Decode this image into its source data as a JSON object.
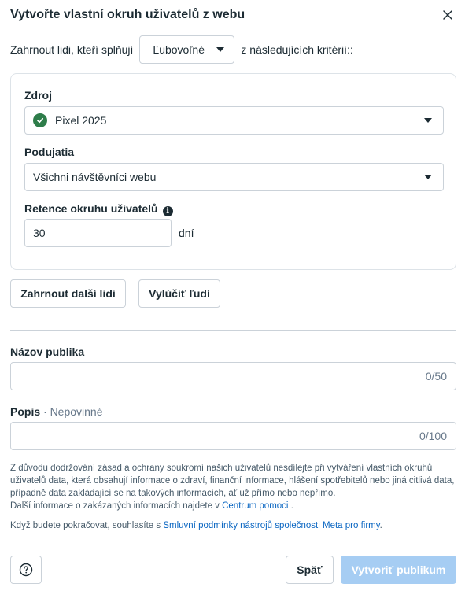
{
  "dialog": {
    "title": "Vytvořte vlastní okruh uživatelů z webu"
  },
  "include": {
    "prefix": "Zahrnout lidi, kteří splňují",
    "match_value": "Ľubovoľné",
    "suffix": "z následujících kritérií::"
  },
  "criteria": {
    "source_label": "Zdroj",
    "source_value": "Pixel 2025",
    "events_label": "Podujatia",
    "events_value": "Všichni návštěvníci webu",
    "retention_label": "Retence okruhu uživatelů",
    "retention_value": "30",
    "retention_unit": "dní"
  },
  "actions": {
    "include_more": "Zahrnout další lidi",
    "exclude": "Vylúčiť ľudí"
  },
  "audience_name": {
    "label": "Názov publika",
    "value": "",
    "counter": "0/50"
  },
  "description": {
    "label": "Popis",
    "optional": "· Nepovinné",
    "value": "",
    "counter": "0/100"
  },
  "notice": {
    "text": "Z důvodu dodržování zásad a ochrany soukromí našich uživatelů nesdílejte při vytváření vlastních okruhů uživatelů data, která obsahují informace o zdraví, finanční informace, hlášení spotřebitelů nebo jiná citlivá data, případně data zakládající se na takových informacích, ať už přímo nebo nepřímo.",
    "more_prefix": "Další informace o zakázaných informacích najdete v",
    "help_link": "Centrum pomoci",
    "more_suffix": "."
  },
  "consent": {
    "prefix": "Když budete pokračovat, souhlasíte s",
    "link": "Smluvní podmínky nástrojů společnosti Meta pro firmy",
    "suffix": "."
  },
  "footer": {
    "help_icon": "question-icon",
    "back": "Späť",
    "create": "Vytvoriť publikum"
  },
  "colors": {
    "accent": "#0a66c2",
    "primary_disabled": "#a6cdf3",
    "success": "#2e7d4a"
  }
}
